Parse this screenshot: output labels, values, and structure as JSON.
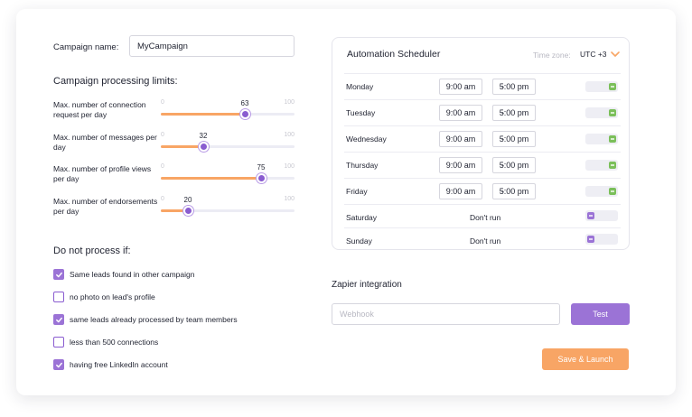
{
  "campaign": {
    "name_label": "Campaign name:",
    "name_value": "MyCampaign"
  },
  "limits": {
    "title": "Campaign processing limits:",
    "sliders": [
      {
        "label": "Max. number of connection request per day",
        "min": "0",
        "max": "100",
        "value": 63
      },
      {
        "label": "Max. number of messages per day",
        "min": "0",
        "max": "100",
        "value": 32
      },
      {
        "label": "Max. number of profile views per day",
        "min": "0",
        "max": "100",
        "value": 75
      },
      {
        "label": "Max. number of endorsements per day",
        "min": "0",
        "max": "100",
        "value": 20
      }
    ]
  },
  "exclusions": {
    "title": "Do not process if:",
    "items": [
      {
        "label": "Same leads found in other campaign",
        "checked": true
      },
      {
        "label": "no photo on lead's profile",
        "checked": false
      },
      {
        "label": "same leads already processed by team members",
        "checked": true
      },
      {
        "label": "less than 500 connections",
        "checked": false
      },
      {
        "label": "having free LinkedIn account",
        "checked": true
      }
    ]
  },
  "scheduler": {
    "title": "Automation Scheduler",
    "timezone_label": "Time zone:",
    "timezone_value": "UTC +3",
    "days": [
      {
        "day": "Monday",
        "from": "9:00 am",
        "to": "5:00 pm",
        "enabled": true
      },
      {
        "day": "Tuesday",
        "from": "9:00 am",
        "to": "5:00 pm",
        "enabled": true
      },
      {
        "day": "Wednesday",
        "from": "9:00 am",
        "to": "5:00 pm",
        "enabled": true
      },
      {
        "day": "Thursday",
        "from": "9:00 am",
        "to": "5:00 pm",
        "enabled": true
      },
      {
        "day": "Friday",
        "from": "9:00 am",
        "to": "5:00 pm",
        "enabled": true
      },
      {
        "day": "Saturday",
        "status": "Don't run",
        "enabled": false
      },
      {
        "day": "Sunday",
        "status": "Don't run",
        "enabled": false
      }
    ]
  },
  "zapier": {
    "title": "Zapier integration",
    "webhook_placeholder": "Webhook",
    "test_label": "Test"
  },
  "actions": {
    "save_launch_label": "Save & Launch"
  },
  "colors": {
    "accent_purple": "#9b73d6",
    "accent_orange": "#f8a565",
    "toggle_on": "#7bbf5a"
  },
  "icons": {
    "timezone_dropdown": "chevron-down-icon",
    "checkbox_check": "check-icon"
  }
}
